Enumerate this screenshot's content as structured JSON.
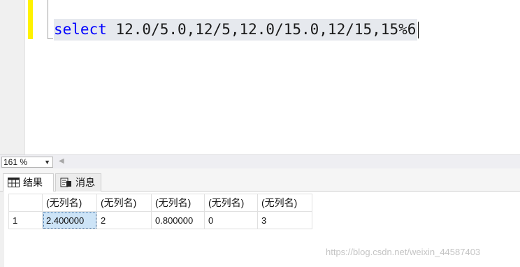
{
  "editor": {
    "query_keyword": "select",
    "query_rest": " 12.0/5.0,12/5,12.0/15.0,12/15,15%6"
  },
  "zoom": {
    "value": "161 %"
  },
  "tabs": [
    {
      "label": "结果",
      "icon": "grid-icon"
    },
    {
      "label": "消息",
      "icon": "message-icon"
    }
  ],
  "results": {
    "columns": [
      "(无列名)",
      "(无列名)",
      "(无列名)",
      "(无列名)",
      "(无列名)"
    ],
    "rows": [
      {
        "row_number": "1",
        "cells": [
          "2.400000",
          "2",
          "0.800000",
          "0",
          "3"
        ]
      }
    ]
  },
  "watermark": "https://blog.csdn.net/weixin_44587403",
  "colors": {
    "keyword": "#0000ff",
    "change_bar": "#fff200",
    "selected_cell": "#cde4f7"
  }
}
